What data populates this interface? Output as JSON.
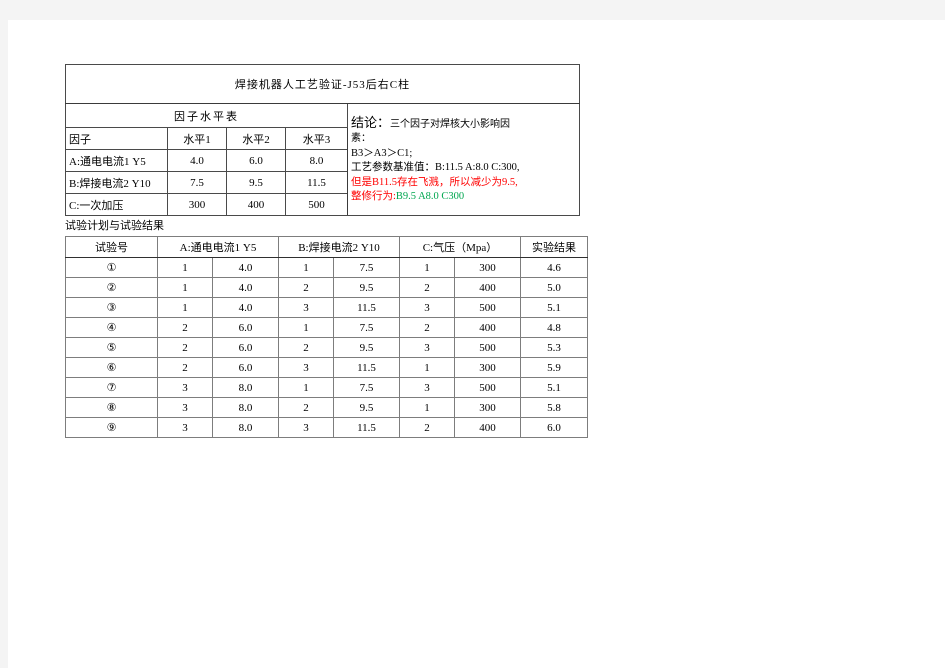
{
  "document": {
    "title": "焊接机器人工艺验证-J53后右C柱"
  },
  "factor_level_table": {
    "title": "因子水平表",
    "headers": [
      "因子",
      "水平1",
      "水平2",
      "水平3"
    ],
    "rows": [
      {
        "factor": "A:通电电流1 Y5",
        "l1": "4.0",
        "l2": "6.0",
        "l3": "8.0"
      },
      {
        "factor": "B:焊接电流2 Y10",
        "l1": "7.5",
        "l2": "9.5",
        "l3": "11.5"
      },
      {
        "factor": "C:一次加压",
        "l1": "300",
        "l2": "400",
        "l3": "500"
      }
    ]
  },
  "conclusion": {
    "label": "结论：",
    "line1_rest": "三个因子对焊核大小影响因",
    "line2": "素：",
    "line3": " B3＞A3＞C1;",
    "line4": "工艺参数基准值：B:11.5 A:8.0 C:300,",
    "line5_red": "但是B11.5存在飞溅，所以减少为9.5,",
    "line6_red": "整修行为:",
    "line6_green": "B9.5 A8.0 C300"
  },
  "plan_section": {
    "label": "试验计划与试验结果",
    "headers": {
      "run": "试验号",
      "a": "A:通电电流1 Y5",
      "b": "B:焊接电流2 Y10",
      "c": "C:气压（Mpa）",
      "result": "实验结果"
    },
    "rows": [
      {
        "run": "①",
        "a_lvl": "1",
        "a_val": "4.0",
        "b_lvl": "1",
        "b_val": "7.5",
        "c_lvl": "1",
        "c_val": "300",
        "result": "4.6"
      },
      {
        "run": "②",
        "a_lvl": "1",
        "a_val": "4.0",
        "b_lvl": "2",
        "b_val": "9.5",
        "c_lvl": "2",
        "c_val": "400",
        "result": "5.0"
      },
      {
        "run": "③",
        "a_lvl": "1",
        "a_val": "4.0",
        "b_lvl": "3",
        "b_val": "11.5",
        "c_lvl": "3",
        "c_val": "500",
        "result": "5.1"
      },
      {
        "run": "④",
        "a_lvl": "2",
        "a_val": "6.0",
        "b_lvl": "1",
        "b_val": "7.5",
        "c_lvl": "2",
        "c_val": "400",
        "result": "4.8"
      },
      {
        "run": "⑤",
        "a_lvl": "2",
        "a_val": "6.0",
        "b_lvl": "2",
        "b_val": "9.5",
        "c_lvl": "3",
        "c_val": "500",
        "result": "5.3"
      },
      {
        "run": "⑥",
        "a_lvl": "2",
        "a_val": "6.0",
        "b_lvl": "3",
        "b_val": "11.5",
        "c_lvl": "1",
        "c_val": "300",
        "result": "5.9"
      },
      {
        "run": "⑦",
        "a_lvl": "3",
        "a_val": "8.0",
        "b_lvl": "1",
        "b_val": "7.5",
        "c_lvl": "3",
        "c_val": "500",
        "result": "5.1"
      },
      {
        "run": "⑧",
        "a_lvl": "3",
        "a_val": "8.0",
        "b_lvl": "2",
        "b_val": "9.5",
        "c_lvl": "1",
        "c_val": "300",
        "result": "5.8"
      },
      {
        "run": "⑨",
        "a_lvl": "3",
        "a_val": "8.0",
        "b_lvl": "3",
        "b_val": "11.5",
        "c_lvl": "2",
        "c_val": "400",
        "result": "6.0"
      }
    ]
  },
  "colors": {
    "red": "#ff0000",
    "green": "#00a64f",
    "grid": "#7d7d7d",
    "outline": "#3a3a3a"
  }
}
